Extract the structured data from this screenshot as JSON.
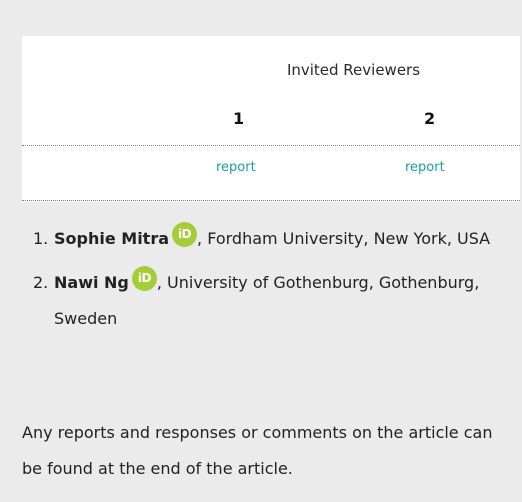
{
  "reviewers_panel": {
    "title": "Invited Reviewers",
    "columns": [
      {
        "number": "1",
        "report_label": "report"
      },
      {
        "number": "2",
        "report_label": "report"
      }
    ]
  },
  "reviewers": [
    {
      "index": "1.",
      "name": "Sophie Mitra",
      "orcid_icon": "iD",
      "affiliation": ", Fordham University, New York, USA"
    },
    {
      "index": "2.",
      "name": "Nawi Ng",
      "orcid_icon": "iD",
      "affiliation": ", University of Gothenburg, Gothenburg, Sweden"
    }
  ],
  "footnote": "Any reports and responses or comments on the article can be found at the end of the article.",
  "colors": {
    "background": "#ebebeb",
    "panel": "#ffffff",
    "link": "#1a9d9d",
    "orcid": "#a5cd39"
  }
}
